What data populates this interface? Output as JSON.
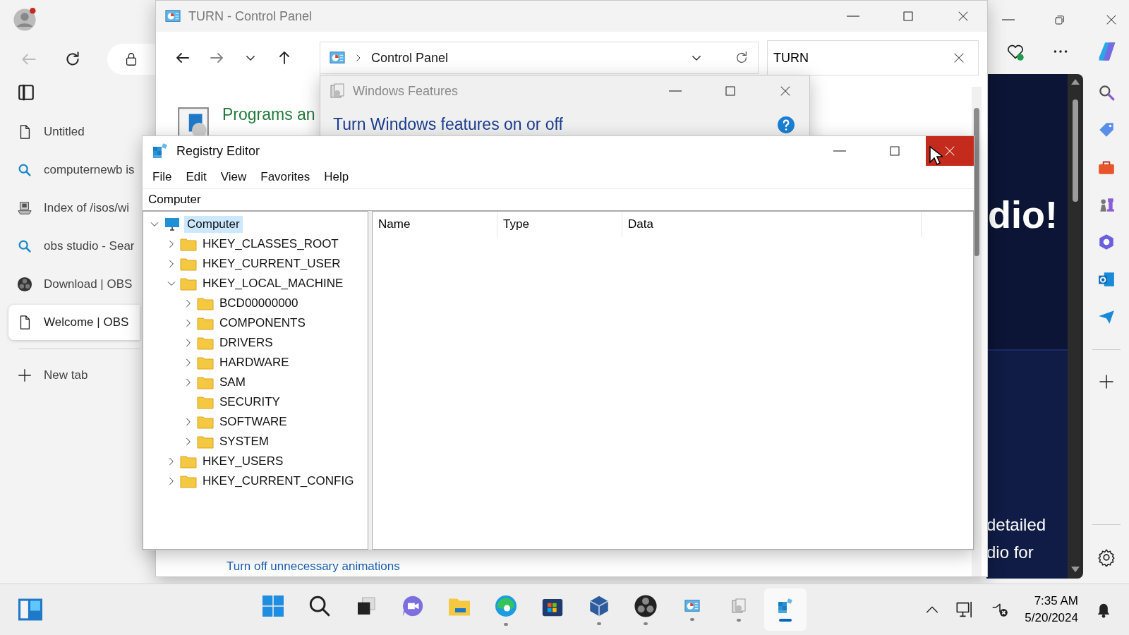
{
  "browser": {
    "tabs": [
      {
        "label": "Untitled",
        "kind": "page",
        "selected": false
      },
      {
        "label": "computernewb is",
        "kind": "search",
        "selected": false
      },
      {
        "label": "Index of /isos/wi",
        "kind": "server",
        "selected": false
      },
      {
        "label": "obs studio - Sear",
        "kind": "search",
        "selected": false
      },
      {
        "label": "Download | OBS",
        "kind": "obs",
        "selected": false
      },
      {
        "label": "Welcome | OBS",
        "kind": "page",
        "selected": true
      }
    ],
    "new_tab": "New tab",
    "page": {
      "heading": "dio!",
      "lines": [
        "detailed",
        "dio for"
      ]
    }
  },
  "control_panel": {
    "title": "TURN - Control Panel",
    "address": "Control Panel",
    "search": "TURN",
    "heading": "Programs an",
    "link": "Turn off unnecessary animations"
  },
  "windows_features": {
    "title": "Windows Features",
    "heading": "Turn Windows features on or off"
  },
  "registry": {
    "title": "Registry Editor",
    "menu": [
      "File",
      "Edit",
      "View",
      "Favorites",
      "Help"
    ],
    "path": "Computer",
    "columns": [
      "Name",
      "Type",
      "Data"
    ],
    "tree": {
      "label": "Computer",
      "kind": "branch",
      "selected": true,
      "expanded": true,
      "children": [
        {
          "label": "HKEY_CLASSES_ROOT",
          "kind": "branch",
          "selected": false,
          "expanded": false
        },
        {
          "label": "HKEY_CURRENT_USER",
          "kind": "branch",
          "selected": false,
          "expanded": false
        },
        {
          "label": "HKEY_LOCAL_MACHINE",
          "kind": "branch",
          "selected": false,
          "expanded": true,
          "children": [
            {
              "label": "BCD00000000",
              "kind": "branch",
              "selected": false,
              "expanded": false
            },
            {
              "label": "COMPONENTS",
              "kind": "branch",
              "selected": false,
              "expanded": false
            },
            {
              "label": "DRIVERS",
              "kind": "branch",
              "selected": false,
              "expanded": false
            },
            {
              "label": "HARDWARE",
              "kind": "branch",
              "selected": false,
              "expanded": false
            },
            {
              "label": "SAM",
              "kind": "branch",
              "selected": false,
              "expanded": false
            },
            {
              "label": "SECURITY",
              "kind": "leaf",
              "selected": false
            },
            {
              "label": "SOFTWARE",
              "kind": "branch",
              "selected": false,
              "expanded": false
            },
            {
              "label": "SYSTEM",
              "kind": "branch",
              "selected": false,
              "expanded": false
            }
          ]
        },
        {
          "label": "HKEY_USERS",
          "kind": "branch",
          "selected": false,
          "expanded": false
        },
        {
          "label": "HKEY_CURRENT_CONFIG",
          "kind": "branch",
          "selected": false,
          "expanded": false
        }
      ]
    }
  },
  "taskbar": {
    "apps": [
      {
        "kind": "start",
        "running": false,
        "active": false
      },
      {
        "kind": "search",
        "running": false,
        "active": false
      },
      {
        "kind": "taskview",
        "running": false,
        "active": false
      },
      {
        "kind": "meet",
        "running": false,
        "active": false
      },
      {
        "kind": "explorer",
        "running": false,
        "active": false
      },
      {
        "kind": "edge",
        "running": true,
        "active": false
      },
      {
        "kind": "store",
        "running": false,
        "active": false
      },
      {
        "kind": "vbox",
        "running": true,
        "active": false
      },
      {
        "kind": "obs",
        "running": true,
        "active": false
      },
      {
        "kind": "controlpanel",
        "running": true,
        "active": false
      },
      {
        "kind": "features",
        "running": true,
        "active": false
      },
      {
        "kind": "regedit",
        "running": true,
        "active": true
      }
    ],
    "time": "7:35 AM",
    "date": "5/20/2024"
  }
}
